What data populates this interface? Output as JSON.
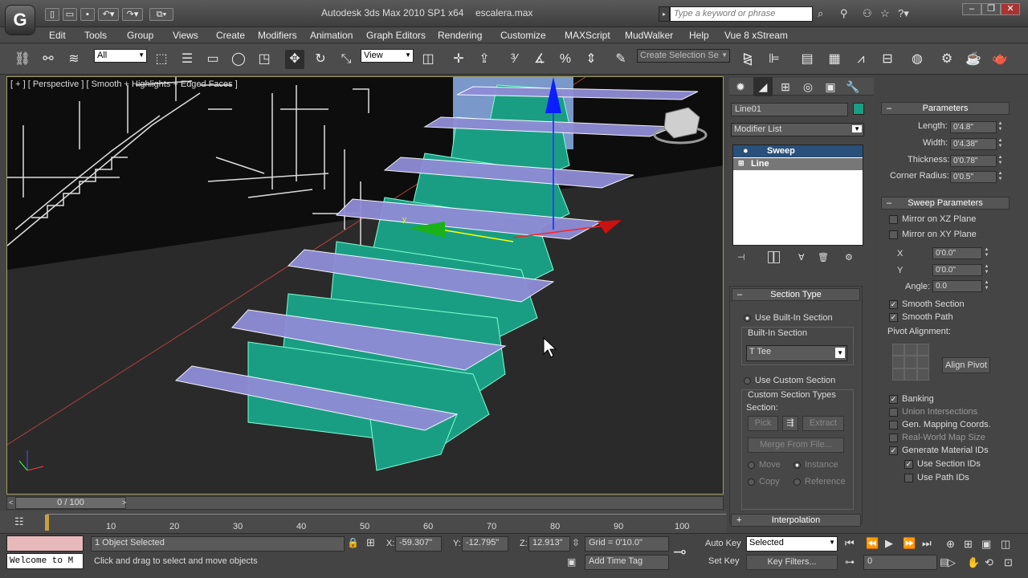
{
  "titlebar": {
    "logo": "G",
    "app_title": "Autodesk 3ds Max  2010 SP1 x64",
    "file_name": "escalera.max",
    "search_placeholder": "Type a keyword or phrase"
  },
  "menu": [
    "Edit",
    "Tools",
    "Group",
    "Views",
    "Create",
    "Modifiers",
    "Animation",
    "Graph Editors",
    "Rendering",
    "Customize",
    "MAXScript",
    "MudWalker",
    "Help",
    "Vue 8 xStream"
  ],
  "toolbar": {
    "selection_filter": "All",
    "ref_coord": "View",
    "named_selection": "Create Selection Se"
  },
  "viewport": {
    "label": "[ + ] [ Perspective ] [ Smooth + Highlights + Edged Faces ]",
    "axis_x": "x",
    "axis_y": "y",
    "axis_z": "z"
  },
  "command_panel": {
    "object_name": "Line01",
    "object_color": "#1a9e83",
    "modifier_list": "Modifier List",
    "stack": [
      {
        "label": "Sweep",
        "selected": true
      },
      {
        "label": "Line",
        "selected": false
      }
    ],
    "section_type": {
      "header": "Section Type",
      "use_builtin": "Use Built-In Section",
      "builtin_group": "Built-In Section",
      "builtin_value": "Tee",
      "use_custom": "Use Custom Section",
      "custom_group": "Custom Section Types",
      "section_label": "Section:",
      "pick": "Pick",
      "extract": "Extract",
      "merge": "Merge From File...",
      "move": "Move",
      "instance": "Instance",
      "copy": "Copy",
      "reference": "Reference"
    },
    "interpolation": "Interpolation"
  },
  "parameters": {
    "header": "Parameters",
    "length_label": "Length:",
    "length": "0'4.8\"",
    "width_label": "Width:",
    "width": "0'4.38\"",
    "thickness_label": "Thickness:",
    "thickness": "0'0.78\"",
    "corner_label": "Corner Radius:",
    "corner": "0'0.5\""
  },
  "sweep_params": {
    "header": "Sweep Parameters",
    "mirror_xz": "Mirror on XZ Plane",
    "mirror_xy": "Mirror on XY Plane",
    "x_label": "X",
    "x": "0'0.0\"",
    "y_label": "Y",
    "y": "0'0.0\"",
    "angle_label": "Angle:",
    "angle": "0.0",
    "smooth_section": "Smooth Section",
    "smooth_path": "Smooth Path",
    "pivot_alignment": "Pivot Alignment:",
    "align_pivot": "Align Pivot",
    "banking": "Banking",
    "union": "Union Intersections",
    "gen_mapping": "Gen. Mapping Coords.",
    "real_world": "Real-World Map Size",
    "gen_mat_ids": "Generate Material IDs",
    "use_section_ids": "Use Section IDs",
    "use_path_ids": "Use Path IDs"
  },
  "timeline": {
    "frame": "0 / 100",
    "ticks": [
      "10",
      "20",
      "30",
      "40",
      "50",
      "60",
      "70",
      "80",
      "90",
      "100"
    ]
  },
  "status": {
    "maxscript": "Welcome to M",
    "selected": "1 Object Selected",
    "prompt": "Click and drag to select and move objects",
    "x_label": "X:",
    "x": "-59.307\"",
    "y_label": "Y:",
    "y": "-12.795\"",
    "z_label": "Z:",
    "z": "12.913\"",
    "grid": "Grid = 0'10.0\"",
    "add_time_tag": "Add Time Tag",
    "auto_key": "Auto Key",
    "set_key": "Set Key",
    "key_mode": "Selected",
    "key_filters": "Key Filters...",
    "frame_field": "0"
  }
}
